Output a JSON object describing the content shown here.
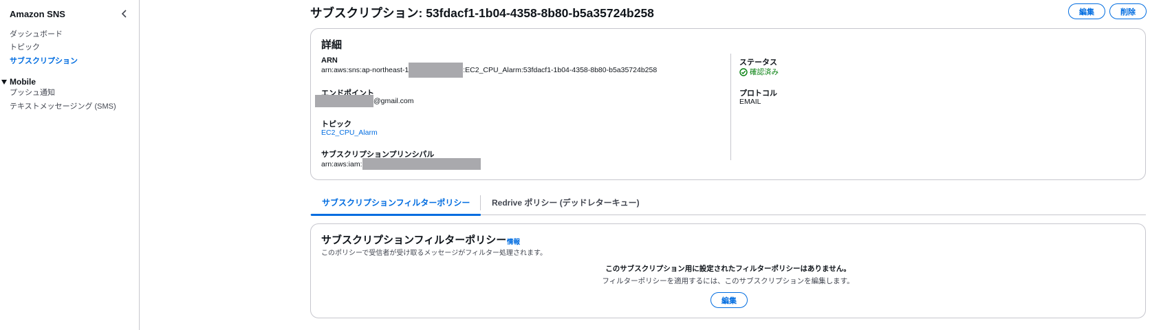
{
  "sidebar": {
    "title": "Amazon SNS",
    "items": [
      {
        "label": "ダッシュボード"
      },
      {
        "label": "トピック"
      },
      {
        "label": "サブスクリプション"
      }
    ],
    "section": {
      "label": "Mobile",
      "items": [
        {
          "label": "プッシュ通知"
        },
        {
          "label": "テキストメッセージング (SMS)"
        }
      ]
    }
  },
  "header": {
    "title": "サブスクリプション: 53fdacf1-1b04-4358-8b80-b5a35724b258",
    "edit_label": "編集",
    "delete_label": "削除"
  },
  "details": {
    "title": "詳細",
    "arn": {
      "label": "ARN",
      "prefix": "arn:aws:sns:ap-northeast-1",
      "suffix": ":EC2_CPU_Alarm:53fdacf1-1b04-4358-8b80-b5a35724b258"
    },
    "endpoint": {
      "label": "エンドポイント",
      "suffix": "@gmail.com"
    },
    "topic": {
      "label": "トピック",
      "value": "EC2_CPU_Alarm"
    },
    "principal": {
      "label": "サブスクリプションプリンシパル",
      "prefix": "arn:aws:iam:"
    },
    "status": {
      "label": "ステータス",
      "value": "確認済み",
      "color": "#037f0c"
    },
    "protocol": {
      "label": "プロトコル",
      "value": "EMAIL"
    }
  },
  "tabs": [
    {
      "label": "サブスクリプションフィルターポリシー"
    },
    {
      "label": "Redrive ポリシー (デッドレターキュー)"
    }
  ],
  "filter_policy": {
    "title": "サブスクリプションフィルターポリシー",
    "info_label": "情報",
    "description": "このポリシーで受信者が受け取るメッセージがフィルター処理されます。",
    "empty_title": "このサブスクリプション用に設定されたフィルターポリシーはありません。",
    "empty_description": "フィルターポリシーを適用するには、このサブスクリプションを編集します。",
    "edit_label": "編集"
  },
  "colors": {
    "accent": "#006ce0",
    "border": "#c6c6cd",
    "redaction": "#a9a9ad"
  }
}
